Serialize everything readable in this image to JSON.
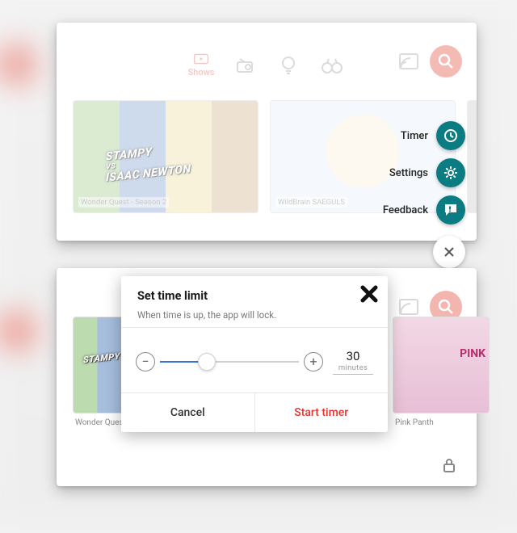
{
  "nav": {
    "shows_label": "Shows"
  },
  "fab": {
    "items": [
      {
        "label": "Timer",
        "icon": "clock-icon"
      },
      {
        "label": "Settings",
        "icon": "gear-icon"
      },
      {
        "label": "Feedback",
        "icon": "feedback-icon"
      }
    ]
  },
  "videos_top": [
    {
      "title": "Wonder Quest - Season 2",
      "banner_line1": "STAMPY",
      "banner_vs": "VS",
      "banner_line2": "ISAAC NEWTON"
    },
    {
      "title": "WildBrain SAEGULS"
    }
  ],
  "videos_bottom": [
    {
      "title": "Wonder Quest - Sea"
    },
    {
      "title": ""
    },
    {
      "title": ""
    },
    {
      "title": "Pink Panth",
      "overlay": "PINK"
    }
  ],
  "dialog": {
    "title": "Set time limit",
    "subtitle": "When time is up, the app will lock.",
    "value": "30",
    "unit": "minutes",
    "cancel_label": "Cancel",
    "start_label": "Start timer"
  }
}
